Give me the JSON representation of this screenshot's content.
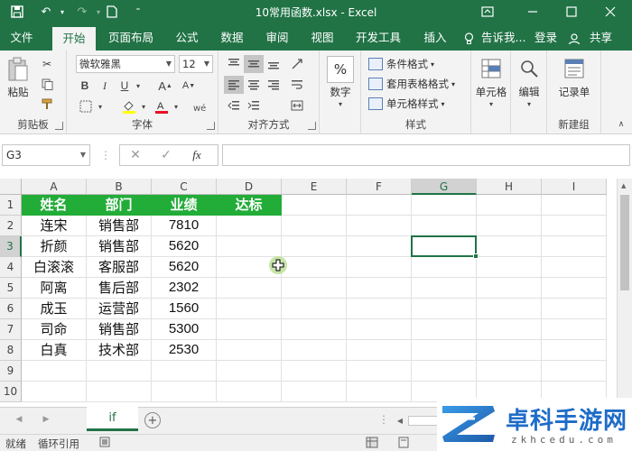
{
  "titlebar": {
    "document_title": "10常用函数.xlsx - Excel"
  },
  "tabs": [
    {
      "label": "文件",
      "active": false
    },
    {
      "label": "开始",
      "active": true
    },
    {
      "label": "页面布局",
      "active": false
    },
    {
      "label": "公式",
      "active": false
    },
    {
      "label": "数据",
      "active": false
    },
    {
      "label": "审阅",
      "active": false
    },
    {
      "label": "视图",
      "active": false
    },
    {
      "label": "开发工具",
      "active": false
    },
    {
      "label": "插入",
      "active": false
    }
  ],
  "tellme": "告诉我...",
  "signin": "登录",
  "share": "共享",
  "ribbon": {
    "clipboard": {
      "paste_label": "粘贴",
      "group_label": "剪贴板"
    },
    "font": {
      "font_name": "微软雅黑",
      "font_size": "12",
      "group_label": "字体"
    },
    "alignment": {
      "group_label": "对齐方式"
    },
    "number": {
      "label": "数字"
    },
    "styles": {
      "conditional_format": "条件格式",
      "table_format": "套用表格格式",
      "cell_style": "单元格样式",
      "group_label": "样式"
    },
    "cells": {
      "label": "单元格"
    },
    "editing": {
      "label": "编辑"
    },
    "newgroup": {
      "record_label": "记录单",
      "group_label": "新建组"
    }
  },
  "formula_bar": {
    "name_box": "G3",
    "fx": "fx",
    "formula": ""
  },
  "grid": {
    "columns": [
      "A",
      "B",
      "C",
      "D",
      "E",
      "F",
      "G",
      "H",
      "I"
    ],
    "rows": [
      "1",
      "2",
      "3",
      "4",
      "5",
      "6",
      "7",
      "8",
      "9",
      "10"
    ],
    "selected_cell": "G3",
    "header_row": [
      "姓名",
      "部门",
      "业绩",
      "达标"
    ],
    "data_rows": [
      [
        "连宋",
        "销售部",
        "7810",
        ""
      ],
      [
        "折颜",
        "销售部",
        "5620",
        ""
      ],
      [
        "白滚滚",
        "客服部",
        "5620",
        ""
      ],
      [
        "阿离",
        "售后部",
        "2302",
        ""
      ],
      [
        "成玉",
        "运营部",
        "1560",
        ""
      ],
      [
        "司命",
        "销售部",
        "5300",
        ""
      ],
      [
        "白真",
        "技术部",
        "2530",
        ""
      ]
    ]
  },
  "sheets": [
    {
      "name": "if",
      "active": true
    }
  ],
  "statusbar": {
    "mode": "就绪",
    "message": "循环引用"
  },
  "watermark": {
    "brand": "卓科手游网",
    "domain": "zkhcedu.com"
  },
  "colors": {
    "excel_green": "#217346",
    "header_fill": "#22ac38"
  }
}
